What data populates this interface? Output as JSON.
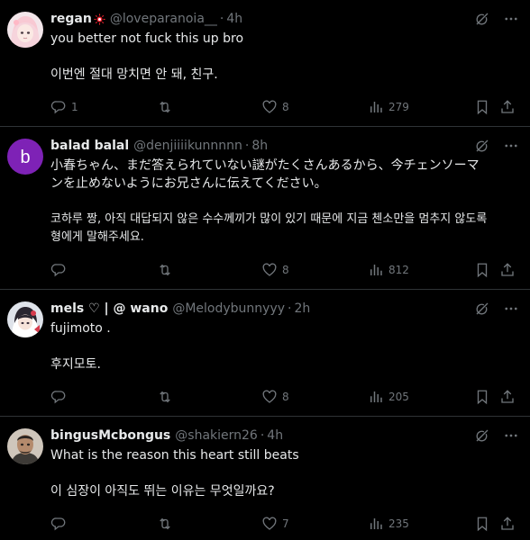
{
  "colors": {
    "background": "#000000",
    "text": "#e7e9ea",
    "muted": "#71767b",
    "divider": "#2f3336"
  },
  "posts": [
    {
      "name": "regan",
      "badge": "sun-badge-icon",
      "handle": "@loveparanoia__",
      "time": "4h",
      "lines": [
        "you better not fuck this up bro"
      ],
      "translation": [
        "이번엔 절대 망치면 안 돼, 친구."
      ],
      "replies": "1",
      "reposts": "",
      "likes": "8",
      "views": "279"
    },
    {
      "name": "balad balal",
      "handle": "@denjiiiikunnnnn",
      "time": "8h",
      "avatar_letter": "b",
      "lines": [
        "小春ちゃん、まだ答えられていない謎がたくさんあるから、今チェンソーマ",
        "ンを止めないようにお兄さんに伝えてください。"
      ],
      "translation": [
        "코하루 짱, 아직 대답되지 않은 수수께끼가 많이 있기 때문에 지금 첸소만을 멈추지 않도록",
        "형에게 말해주세요."
      ],
      "replies": "",
      "reposts": "",
      "likes": "8",
      "views": "812"
    },
    {
      "name": "mels ♡ | @ wano",
      "handle": "@Melodybunnyyy",
      "time": "2h",
      "lines": [
        "fujimoto ."
      ],
      "translation": [
        "후지모토."
      ],
      "replies": "",
      "reposts": "",
      "likes": "8",
      "views": "205"
    },
    {
      "name": "bingusMcbongus",
      "handle": "@shakiern26",
      "time": "4h",
      "lines": [
        "What is the reason this heart still beats"
      ],
      "translation": [
        "이 심장이 아직도 뛰는 이유는 무엇일까요?"
      ],
      "replies": "",
      "reposts": "",
      "likes": "7",
      "views": "235"
    }
  ]
}
